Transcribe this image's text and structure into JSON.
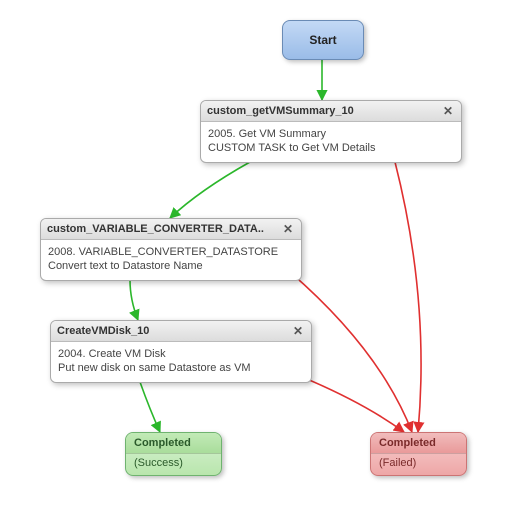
{
  "start": {
    "label": "Start"
  },
  "tasks": {
    "t1": {
      "title": "custom_getVMSummary_10",
      "line1": "2005. Get VM Summary",
      "line2": "CUSTOM TASK to Get VM Details"
    },
    "t2": {
      "title": "custom_VARIABLE_CONVERTER_DATA..",
      "line1": "2008. VARIABLE_CONVERTER_DATASTORE",
      "line2": "Convert text to Datastore Name"
    },
    "t3": {
      "title": "CreateVMDisk_10",
      "line1": "2004. Create VM Disk",
      "line2": "Put new disk on same Datastore as VM"
    }
  },
  "ends": {
    "success": {
      "title": "Completed",
      "sub": "(Success)"
    },
    "failed": {
      "title": "Completed",
      "sub": "(Failed)"
    }
  },
  "icons": {
    "close": "✕"
  },
  "colors": {
    "success_edge": "#2bb72b",
    "failure_edge": "#e03030"
  }
}
